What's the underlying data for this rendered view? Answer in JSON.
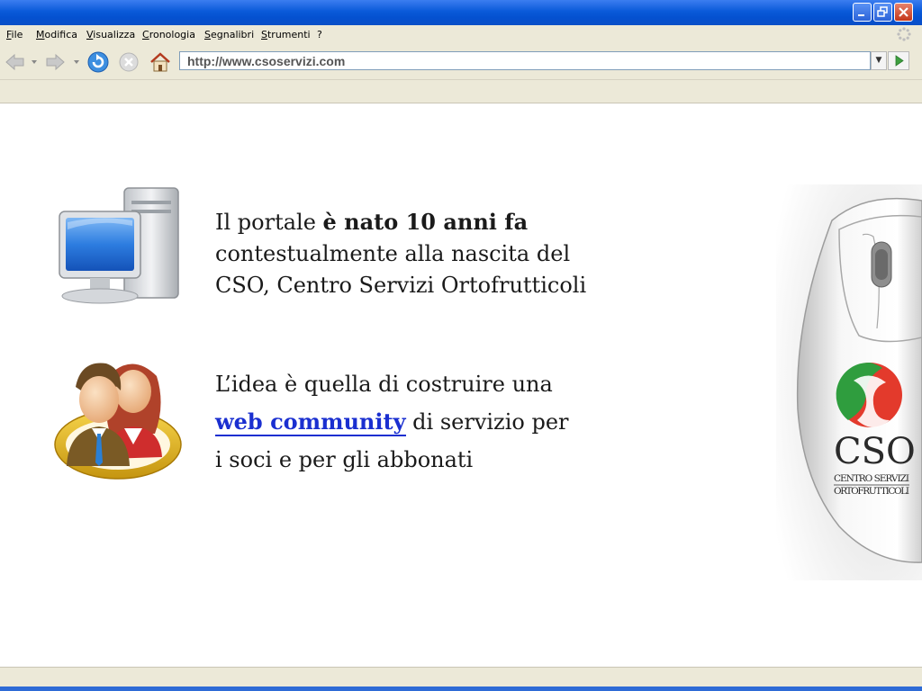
{
  "window": {
    "title": "",
    "controls": [
      "minimize-icon",
      "restore-icon",
      "close-icon"
    ]
  },
  "menu": {
    "items": [
      {
        "label": "File"
      },
      {
        "label": "Modifica"
      },
      {
        "label": "Visualizza"
      },
      {
        "label": "Cronologia"
      },
      {
        "label": "Segnalibri"
      },
      {
        "label": "Strumenti"
      },
      {
        "label": "?"
      }
    ]
  },
  "toolbar": {
    "url": "http://www.csoservizi.com",
    "icons": [
      "back-icon",
      "forward-icon",
      "reload-icon",
      "stop-icon",
      "home-icon",
      "go-icon"
    ]
  },
  "content": {
    "block1": {
      "prefix": "Il portale ",
      "bold": "è nato 10 anni fa",
      "line2": "contestualmente alla nascita del",
      "line3": "CSO, Centro Servizi Ortofrutticoli"
    },
    "block2": {
      "line1": "L’idea è quella di costruire una",
      "link": "web community",
      "line2_suffix": " di servizio per",
      "line3": "i soci e per gli abbonati"
    },
    "logo": {
      "name": "CSO",
      "sub1": "CENTRO SERVIZI",
      "sub2": "ORTOFRUTTICOLI"
    }
  },
  "colors": {
    "titlebar": "#0a5ad9",
    "chrome": "#ece9d8",
    "link": "#1a2fd0",
    "logo_red": "#e0261c",
    "logo_green": "#2e9a3c"
  }
}
